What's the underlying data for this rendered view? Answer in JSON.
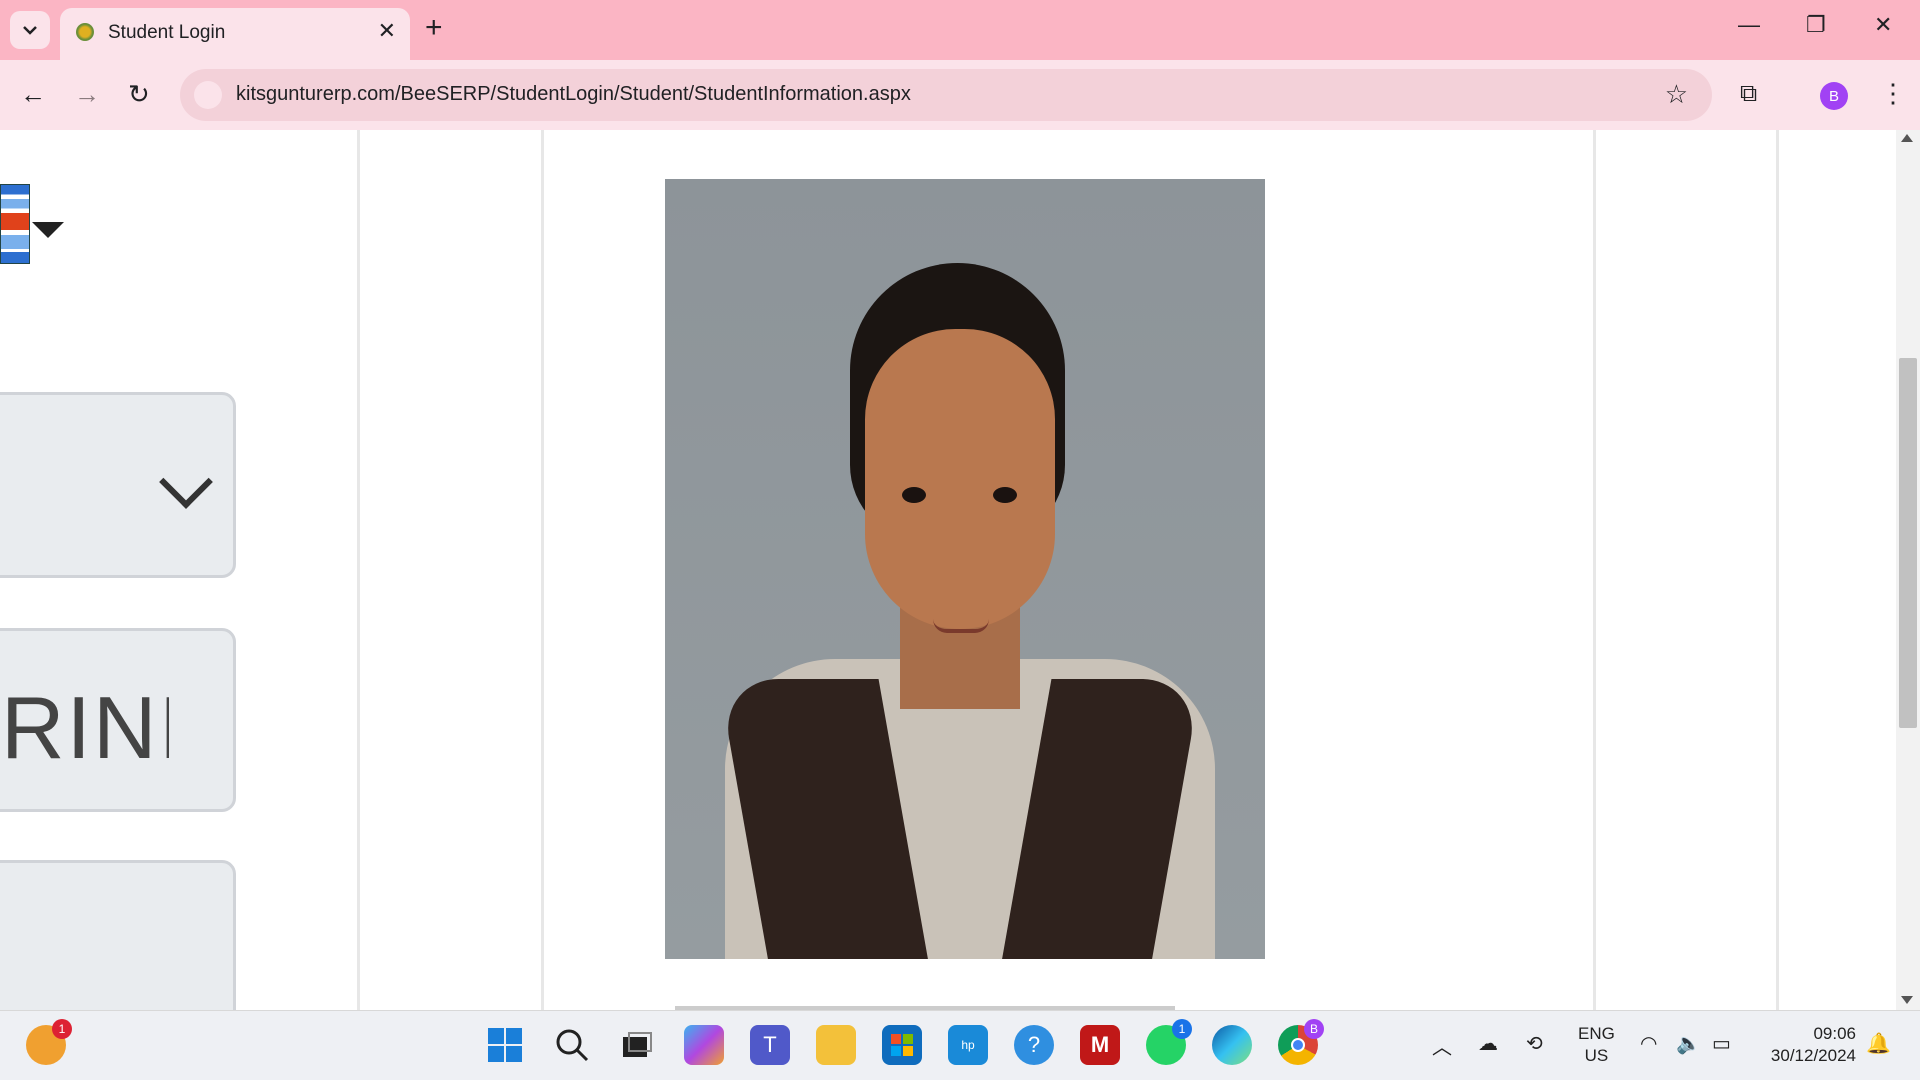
{
  "tab": {
    "title": "Student Login"
  },
  "omnibox": {
    "url": "kitsgunturerp.com/BeeSERP/StudentLogin/Student/StudentInformation.aspx"
  },
  "profile": {
    "initial": "B"
  },
  "page": {
    "name_fragment": "RINI\\"
  },
  "taskbar": {
    "weather_badge": "1",
    "whatsapp_badge": "1",
    "chrome_badge": "B",
    "lang_line1": "ENG",
    "lang_line2": "US",
    "time": "09:06",
    "date": "30/12/2024"
  }
}
